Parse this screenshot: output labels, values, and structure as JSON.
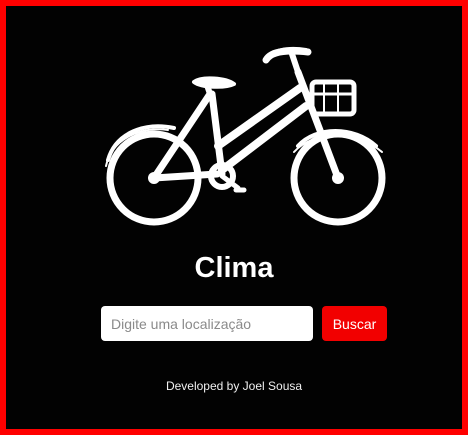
{
  "app": {
    "title": "Clima",
    "logo_icon": "bicycle-icon"
  },
  "search": {
    "placeholder": "Digite uma localização",
    "value": "",
    "button_label": "Buscar"
  },
  "footer": {
    "credit": "Developed by Joel Sousa"
  },
  "colors": {
    "background": "#020202",
    "border": "#ff0000",
    "accent": "#f20000",
    "text": "#ffffff"
  }
}
